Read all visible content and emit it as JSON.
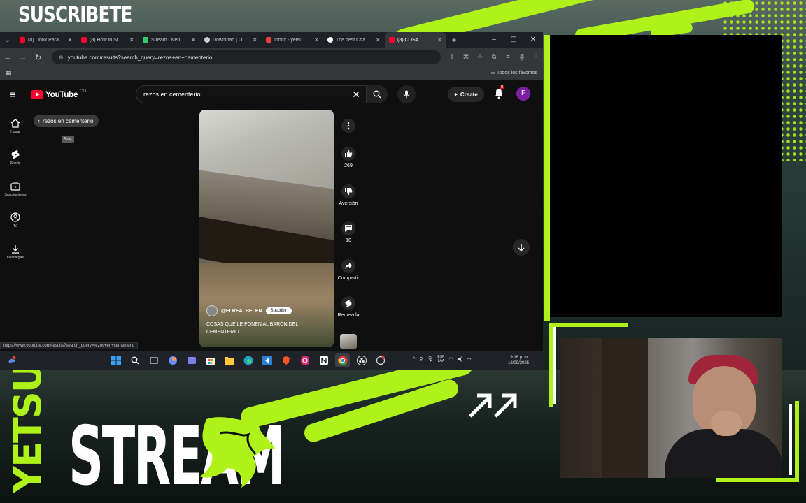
{
  "overlay": {
    "subscribe_text": "SUSCRIBETE",
    "brand_vertical": "YETSUS",
    "brand_main": "STREAM",
    "accent_color": "#aef21a",
    "arrow_icon": "double-diagonal-arrow-icon"
  },
  "browser": {
    "tabs": [
      {
        "title": "(8) Linux Para",
        "favicon": "youtube",
        "color": "#ff0033"
      },
      {
        "title": "(8) How to St",
        "favicon": "youtube",
        "color": "#ff0033"
      },
      {
        "title": "Stream Overl",
        "favicon": "editor",
        "color": "#2ecc71"
      },
      {
        "title": "Download | O",
        "favicon": "obs",
        "color": "#cccccc"
      },
      {
        "title": "Inbox - yetsu",
        "favicon": "gmail",
        "color": "#ea4335"
      },
      {
        "title": "The best Cha",
        "favicon": "chatgpt",
        "color": "#ffffff"
      },
      {
        "title": "(8) COSA",
        "favicon": "youtube",
        "color": "#ff0033",
        "active": true
      }
    ],
    "new_tab": "+",
    "window_controls": {
      "minimize": "–",
      "maximize": "▢",
      "close": "✕"
    },
    "url": "youtube.com/results?search_query=rezos+en+cementerio",
    "all_bookmarks": "Todos los favoritos",
    "status_url": "https://www.youtube.com/results?search_query=rezos+en+cementerio"
  },
  "youtube": {
    "logo_text": "YouTube",
    "logo_country": "CO",
    "search_query": "rezos en cementerio",
    "create_label": "Create",
    "notification_count": "8",
    "avatar_letter": "F",
    "sidebar": [
      {
        "label": "Hogar",
        "icon": "home-icon"
      },
      {
        "label": "Shorts",
        "icon": "shorts-icon"
      },
      {
        "label": "Suscripciones",
        "icon": "subscriptions-icon"
      },
      {
        "label": "Tú",
        "icon": "you-icon"
      },
      {
        "label": "Descargas",
        "icon": "download-icon"
      }
    ],
    "chip_label": "rezos en cementerio",
    "tooltip": "Atrás",
    "short": {
      "channel": "@ELREALBELEN",
      "subscribe": "Suscribir",
      "caption": "COSAS QUE LE PONEN AL BARÓN DEL CEMENTERIO."
    },
    "actions": {
      "likes": "269",
      "dislike": "Aversión",
      "comments": "10",
      "share": "Compartir",
      "remix": "Remezcla"
    }
  },
  "taskbar": {
    "lang": "ESP",
    "lang_sub": "LAA",
    "time": "9:16 p. m.",
    "date": "18/09/2025"
  }
}
